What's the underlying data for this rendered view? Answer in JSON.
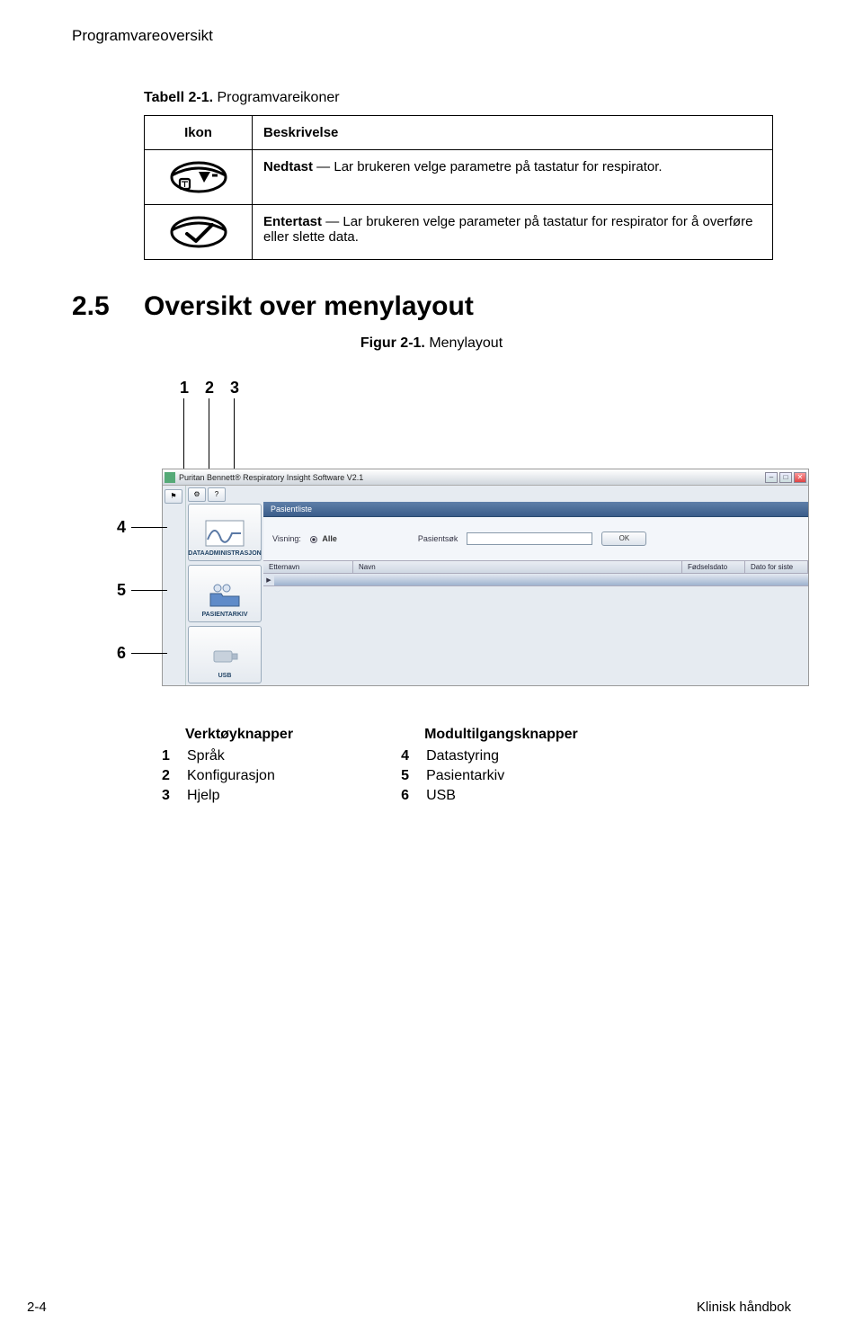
{
  "header_section": "Programvareoversikt",
  "table_caption_bold": "Tabell 2-1.",
  "table_caption_rest": "  Programvareikoner",
  "table": {
    "col_icon": "Ikon",
    "col_desc": "Beskrivelse",
    "row1_bold": "Nedtast",
    "row1_rest": " — Lar brukeren velge parametre på tastatur for respirator.",
    "row2_bold": "Entertast",
    "row2_rest": " — Lar brukeren velge parameter på tastatur for respirator for å overføre eller slette data."
  },
  "section25_num": "2.5",
  "section25_title": "Oversikt over menylayout",
  "fig_caption_bold": "Figur 2-1.",
  "fig_caption_rest": "  Menylayout",
  "callouts": {
    "c1": "1",
    "c2": "2",
    "c3": "3",
    "c4": "4",
    "c5": "5",
    "c6": "6"
  },
  "app": {
    "title": "Puritan Bennett® Respiratory Insight Software V2.1",
    "panel_tab": "Pasientliste",
    "visning_label": "Visning:",
    "alle_label": "Alle",
    "pasientsok_label": "Pasientsøk",
    "ok": "OK",
    "grid": {
      "etternavn": "Etternavn",
      "navn": "Navn",
      "fodselsdato": "Fødselsdato",
      "dato_siste": "Dato for siste"
    },
    "sidebar": {
      "data_admin": "DATAADMINISTRASJON",
      "pasientarkiv": "PASIENTARKIV",
      "usb": "USB"
    }
  },
  "legend": {
    "left_head": "Verktøyknapper",
    "right_head": "Modultilgangsknapper",
    "l1": "Språk",
    "l2": "Konfigurasjon",
    "l3": "Hjelp",
    "r4": "Datastyring",
    "r5": "Pasientarkiv",
    "r6": "USB"
  },
  "footer": {
    "page": "2-4",
    "book": "Klinisk håndbok"
  }
}
